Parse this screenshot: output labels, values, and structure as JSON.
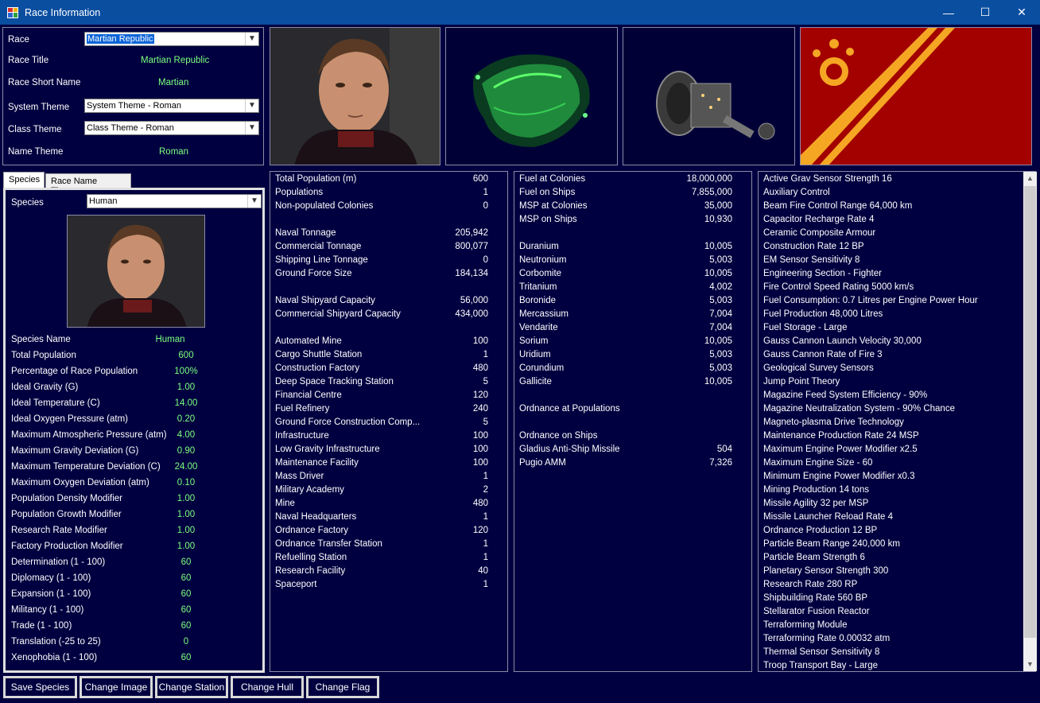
{
  "window": {
    "title": "Race Information",
    "min": "—",
    "max": "☐",
    "close": "✕"
  },
  "race": {
    "race_label": "Race",
    "race_value": "Martian Republic",
    "title_label": "Race Title",
    "title_value": "Martian Republic",
    "short_label": "Race Short Name",
    "short_value": "Martian",
    "system_label": "System Theme",
    "system_value": "System Theme - Roman",
    "class_label": "Class Theme",
    "class_value": "Class Theme - Roman",
    "name_label": "Name Theme",
    "name_value": "Roman"
  },
  "tabs": [
    "Species",
    "Race Name Themes"
  ],
  "species": {
    "label": "Species",
    "value": "Human",
    "rows": [
      {
        "label": "Species Name",
        "value": "Human"
      },
      {
        "label": "Total Population",
        "value": "600"
      },
      {
        "label": "Percentage of Race Population",
        "value": "100%"
      },
      {
        "label": "Ideal Gravity (G)",
        "value": "1.00"
      },
      {
        "label": "Ideal Temperature (C)",
        "value": "14.00"
      },
      {
        "label": "Ideal Oxygen Pressure (atm)",
        "value": "0.20"
      },
      {
        "label": "Maximum Atmospheric Pressure (atm)",
        "value": "4.00"
      },
      {
        "label": "Maximum Gravity Deviation (G)",
        "value": "0.90"
      },
      {
        "label": "Maximum Temperature Deviation (C)",
        "value": "24.00"
      },
      {
        "label": "Maximum Oxygen Deviation (atm)",
        "value": "0.10"
      },
      {
        "label": "Population Density Modifier",
        "value": "1.00"
      },
      {
        "label": "Population Growth Modifier",
        "value": "1.00"
      },
      {
        "label": "Research Rate Modifier",
        "value": "1.00"
      },
      {
        "label": "Factory Production Modifier",
        "value": "1.00"
      },
      {
        "label": "Determination (1 - 100)",
        "value": "60"
      },
      {
        "label": "Diplomacy (1 - 100)",
        "value": "60"
      },
      {
        "label": "Expansion (1 - 100)",
        "value": "60"
      },
      {
        "label": "Militancy (1 - 100)",
        "value": "60"
      },
      {
        "label": "Trade (1 - 100)",
        "value": "60"
      },
      {
        "label": "Translation (-25 to 25)",
        "value": "0"
      },
      {
        "label": "Xenophobia (1 - 100)",
        "value": "60"
      }
    ]
  },
  "stats": [
    {
      "label": "Total Population (m)",
      "value": "600"
    },
    {
      "label": "Populations",
      "value": "1"
    },
    {
      "label": "Non-populated Colonies",
      "value": "0"
    },
    {
      "label": "",
      "value": ""
    },
    {
      "label": "Naval Tonnage",
      "value": "205,942"
    },
    {
      "label": "Commercial Tonnage",
      "value": "800,077"
    },
    {
      "label": "Shipping Line Tonnage",
      "value": "0"
    },
    {
      "label": "Ground Force Size",
      "value": "184,134"
    },
    {
      "label": "",
      "value": ""
    },
    {
      "label": "Naval Shipyard Capacity",
      "value": "56,000"
    },
    {
      "label": "Commercial Shipyard Capacity",
      "value": "434,000"
    },
    {
      "label": "",
      "value": ""
    },
    {
      "label": "Automated Mine",
      "value": "100"
    },
    {
      "label": "Cargo Shuttle Station",
      "value": "1"
    },
    {
      "label": "Construction Factory",
      "value": "480"
    },
    {
      "label": "Deep Space Tracking Station",
      "value": "5"
    },
    {
      "label": "Financial Centre",
      "value": "120"
    },
    {
      "label": "Fuel Refinery",
      "value": "240"
    },
    {
      "label": "Ground Force Construction Comp...",
      "value": "5"
    },
    {
      "label": "Infrastructure",
      "value": "100"
    },
    {
      "label": "Low Gravity Infrastructure",
      "value": "100"
    },
    {
      "label": "Maintenance Facility",
      "value": "100"
    },
    {
      "label": "Mass Driver",
      "value": "1"
    },
    {
      "label": "Military Academy",
      "value": "2"
    },
    {
      "label": "Mine",
      "value": "480"
    },
    {
      "label": "Naval Headquarters",
      "value": "1"
    },
    {
      "label": "Ordnance Factory",
      "value": "120"
    },
    {
      "label": "Ordnance Transfer Station",
      "value": "1"
    },
    {
      "label": "Refuelling Station",
      "value": "1"
    },
    {
      "label": "Research Facility",
      "value": "40"
    },
    {
      "label": "Spaceport",
      "value": "1"
    }
  ],
  "resources": [
    {
      "label": "Fuel at Colonies",
      "value": "18,000,000"
    },
    {
      "label": "Fuel on Ships",
      "value": "7,855,000"
    },
    {
      "label": "MSP at Colonies",
      "value": "35,000"
    },
    {
      "label": "MSP on Ships",
      "value": "10,930"
    },
    {
      "label": "",
      "value": ""
    },
    {
      "label": "Duranium",
      "value": "10,005"
    },
    {
      "label": "Neutronium",
      "value": "5,003"
    },
    {
      "label": "Corbomite",
      "value": "10,005"
    },
    {
      "label": "Tritanium",
      "value": "4,002"
    },
    {
      "label": "Boronide",
      "value": "5,003"
    },
    {
      "label": "Mercassium",
      "value": "7,004"
    },
    {
      "label": "Vendarite",
      "value": "7,004"
    },
    {
      "label": "Sorium",
      "value": "10,005"
    },
    {
      "label": "Uridium",
      "value": "5,003"
    },
    {
      "label": "Corundium",
      "value": "5,003"
    },
    {
      "label": "Gallicite",
      "value": "10,005"
    },
    {
      "label": "",
      "value": ""
    },
    {
      "label": "Ordnance at Populations",
      "value": ""
    },
    {
      "label": "",
      "value": ""
    },
    {
      "label": "Ordnance on Ships",
      "value": ""
    },
    {
      "label": "Gladius Anti-Ship Missile",
      "value": "504"
    },
    {
      "label": "Pugio AMM",
      "value": "7,326"
    }
  ],
  "techs": [
    "Active Grav Sensor Strength 16",
    "Auxiliary Control",
    "Beam Fire Control Range 64,000 km",
    "Capacitor Recharge Rate 4",
    "Ceramic Composite Armour",
    "Construction Rate 12 BP",
    "EM Sensor Sensitivity 8",
    "Engineering Section - Fighter",
    "Fire Control Speed Rating 5000 km/s",
    "Fuel Consumption: 0.7 Litres per Engine Power Hour",
    "Fuel Production 48,000 Litres",
    "Fuel Storage - Large",
    "Gauss Cannon Launch Velocity 30,000",
    "Gauss Cannon Rate of Fire 3",
    "Geological Survey Sensors",
    "Jump Point Theory",
    "Magazine Feed System Efficiency - 90%",
    "Magazine Neutralization System - 90% Chance",
    "Magneto-plasma Drive Technology",
    "Maintenance Production Rate 24 MSP",
    "Maximum Engine Power Modifier x2.5",
    "Maximum Engine Size - 60",
    "Minimum Engine Power Modifier x0.3",
    "Mining Production 14 tons",
    "Missile Agility 32 per MSP",
    "Missile Launcher Reload Rate 4",
    "Ordnance Production 12 BP",
    "Particle Beam Range 240,000 km",
    "Particle Beam Strength 6",
    "Planetary Sensor Strength 300",
    "Research Rate 280 RP",
    "Shipbuilding Rate 560 BP",
    "Stellarator Fusion Reactor",
    "Terraforming Module",
    "Terraforming Rate 0.00032 atm",
    "Thermal Sensor Sensitivity 8",
    "Troop Transport Bay - Large"
  ],
  "buttons": [
    "Save Species",
    "Change Image",
    "Change Station",
    "Change Hull",
    "Change Flag"
  ],
  "colors": {
    "background": "#000040",
    "value_green": "#7cff7c",
    "flag_red": "#a30000",
    "flag_gold": "#f5a623"
  }
}
